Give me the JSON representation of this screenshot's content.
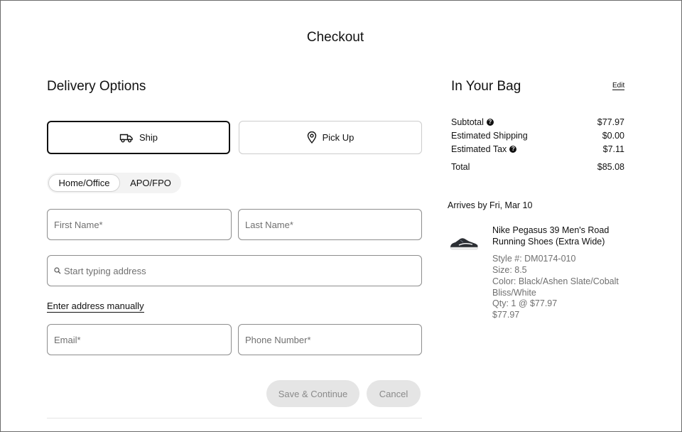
{
  "header": {
    "title": "Checkout"
  },
  "delivery": {
    "heading": "Delivery Options",
    "methods": {
      "ship": "Ship",
      "pickup": "Pick Up"
    },
    "address_types": {
      "home": "Home/Office",
      "apo": "APO/FPO"
    },
    "fields": {
      "first_name": "First Name*",
      "last_name": "Last Name*",
      "address": "Start typing address",
      "email": "Email*",
      "phone": "Phone Number*"
    },
    "manual_link": "Enter address manually",
    "buttons": {
      "save": "Save & Continue",
      "cancel": "Cancel"
    }
  },
  "bag": {
    "heading": "In Your Bag",
    "edit": "Edit",
    "summary": {
      "subtotal_label": "Subtotal",
      "subtotal_value": "$77.97",
      "shipping_label": "Estimated Shipping",
      "shipping_value": "$0.00",
      "tax_label": "Estimated Tax",
      "tax_value": "$7.11",
      "total_label": "Total",
      "total_value": "$85.08"
    },
    "arrives": "Arrives by Fri, Mar 10",
    "product": {
      "name": "Nike Pegasus 39 Men's Road Running Shoes (Extra Wide)",
      "style": "Style #: DM0174-010",
      "size": "Size: 8.5",
      "color": "Color: Black/Ashen Slate/Cobalt Bliss/White",
      "qty": "Qty: 1 @ $77.97",
      "price": "$77.97"
    }
  },
  "icons": {
    "help": "question-circle-icon",
    "truck": "truck-icon",
    "pin": "location-pin-icon",
    "search": "search-icon"
  }
}
